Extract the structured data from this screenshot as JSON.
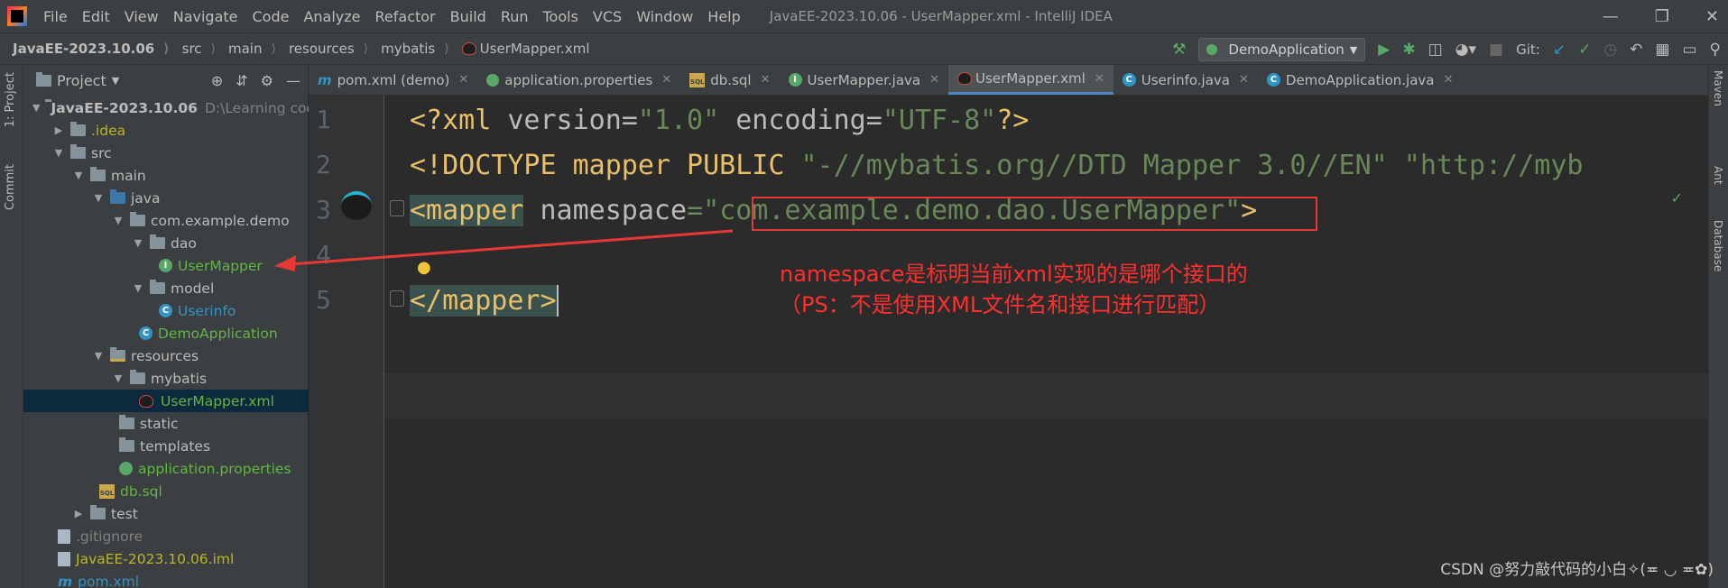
{
  "window": {
    "title": "JavaEE-2023.10.06 - UserMapper.xml - IntelliJ IDEA",
    "menu": [
      "File",
      "Edit",
      "View",
      "Navigate",
      "Code",
      "Analyze",
      "Refactor",
      "Build",
      "Run",
      "Tools",
      "VCS",
      "Window",
      "Help"
    ]
  },
  "breadcrumb": [
    "JavaEE-2023.10.06",
    "src",
    "main",
    "resources",
    "mybatis",
    "UserMapper.xml"
  ],
  "toolbar": {
    "run_config": "DemoApplication",
    "git_label": "Git:"
  },
  "stripes": {
    "left": [
      "1: Project",
      "Commit"
    ],
    "right": [
      "Maven",
      "Ant",
      "Database"
    ]
  },
  "project_panel": {
    "title": "Project",
    "tree": [
      {
        "label": "JavaEE-2023.10.06",
        "extra": "D:\\Learning code"
      },
      {
        "label": ".idea"
      },
      {
        "label": "src"
      },
      {
        "label": "main"
      },
      {
        "label": "java"
      },
      {
        "label": "com.example.demo"
      },
      {
        "label": "dao"
      },
      {
        "label": "UserMapper"
      },
      {
        "label": "model"
      },
      {
        "label": "Userinfo"
      },
      {
        "label": "DemoApplication"
      },
      {
        "label": "resources"
      },
      {
        "label": "mybatis"
      },
      {
        "label": "UserMapper.xml"
      },
      {
        "label": "static"
      },
      {
        "label": "templates"
      },
      {
        "label": "application.properties"
      },
      {
        "label": "db.sql"
      },
      {
        "label": "test"
      },
      {
        "label": ".gitignore"
      },
      {
        "label": "JavaEE-2023.10.06.iml"
      },
      {
        "label": "pom.xml"
      }
    ]
  },
  "tabs": [
    {
      "label": "pom.xml (demo)"
    },
    {
      "label": "application.properties"
    },
    {
      "label": "db.sql"
    },
    {
      "label": "UserMapper.java"
    },
    {
      "label": "UserMapper.xml"
    },
    {
      "label": "Userinfo.java"
    },
    {
      "label": "DemoApplication.java"
    }
  ],
  "editor": {
    "line_numbers": [
      "1",
      "2",
      "3",
      "4",
      "5"
    ],
    "line1": {
      "a": "<?xml ",
      "b": "version",
      "c": "=",
      "d": "\"1.0\"",
      "e": " encoding",
      "f": "=",
      "g": "\"UTF-8\"",
      "h": "?>"
    },
    "line2": {
      "a": "<!DOCTYPE mapper ",
      "b": "PUBLIC ",
      "c": "\"-//mybatis.org//DTD Mapper 3.0//EN\" \"http://myb"
    },
    "line3": {
      "a": "<mapper",
      "b": " namespace",
      "c": "=\"",
      "d": "com.example.demo.dao.UserMapper",
      "e": "\"",
      "f": ">"
    },
    "line5": {
      "a": "</mapper>"
    }
  },
  "annotation": {
    "line1": "namespace是标明当前xml实现的是哪个接口的",
    "line2": "（PS：不是使用XML文件名和接口进行匹配）"
  },
  "watermark": "CSDN @努力敲代码的小白✧(≖ ◡ ≖✿)",
  "colors": {
    "accent": "#4a88c7",
    "annotation": "#ff2f2f"
  }
}
